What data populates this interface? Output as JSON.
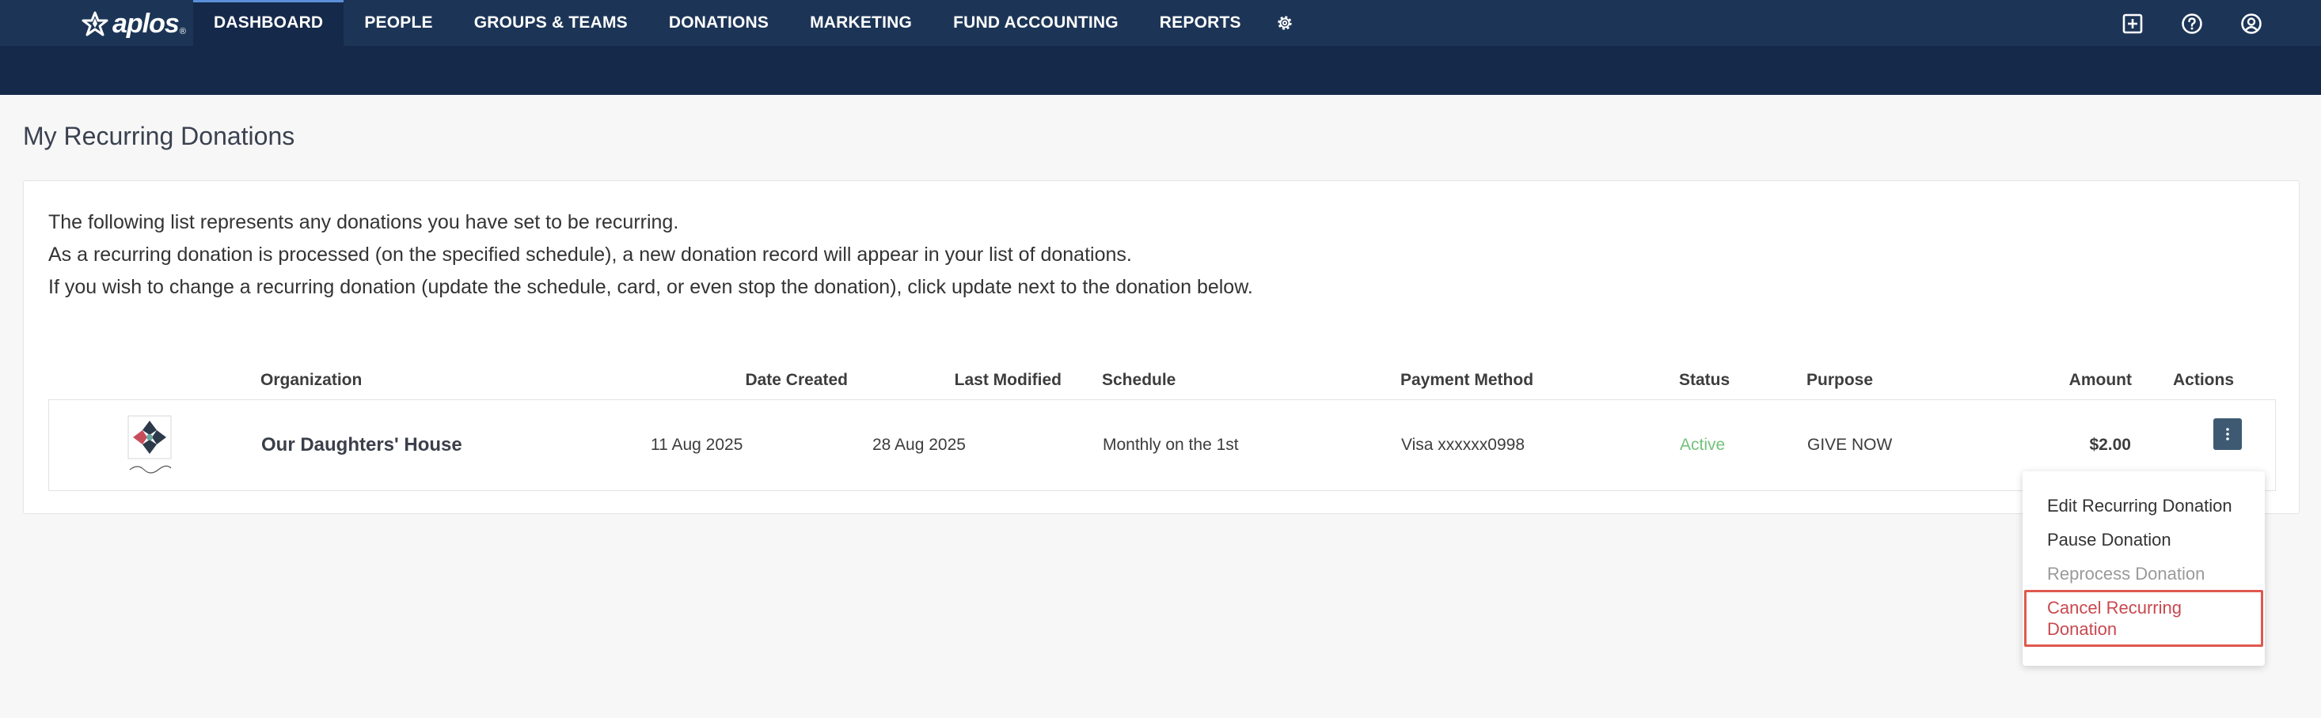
{
  "app": {
    "logo_text": "aplos",
    "logo_reg": "®"
  },
  "nav": {
    "items": [
      "DASHBOARD",
      "PEOPLE",
      "GROUPS & TEAMS",
      "DONATIONS",
      "MARKETING",
      "FUND ACCOUNTING",
      "REPORTS"
    ],
    "active_index": 0,
    "settings_icon": "gear-icon"
  },
  "top_icons": [
    "plus-square-icon",
    "help-circle-icon",
    "user-circle-icon"
  ],
  "page": {
    "title": "My Recurring Donations"
  },
  "intro": {
    "lines": [
      "The following list represents any donations you have set to be recurring.",
      "As a recurring donation is processed (on the specified schedule), a new donation record will appear in your list of donations.",
      "If you wish to change a recurring donation (update the schedule, card, or even stop the donation), click update next to the donation below."
    ]
  },
  "table": {
    "headers": {
      "organization": "Organization",
      "date_created": "Date Created",
      "last_modified": "Last Modified",
      "schedule": "Schedule",
      "payment_method": "Payment Method",
      "status": "Status",
      "purpose": "Purpose",
      "amount": "Amount",
      "actions": "Actions"
    },
    "rows": [
      {
        "organization": "Our Daughters' House",
        "date_created": "11 Aug 2025",
        "last_modified": "28 Aug 2025",
        "schedule": "Monthly on the 1st",
        "payment_method": "Visa xxxxxx0998",
        "status": "Active",
        "purpose": "GIVE NOW",
        "amount": "$2.00"
      }
    ]
  },
  "actions_menu": {
    "items": [
      "Edit Recurring Donation",
      "Pause Donation",
      "Reprocess Donation",
      "Cancel Recurring Donation"
    ]
  },
  "colors": {
    "nav_bg": "#1c3557",
    "subbar_bg": "#15294a",
    "status_active": "#74c27b",
    "cancel_highlight": "#e0584f",
    "actions_button": "#3e5a73"
  }
}
